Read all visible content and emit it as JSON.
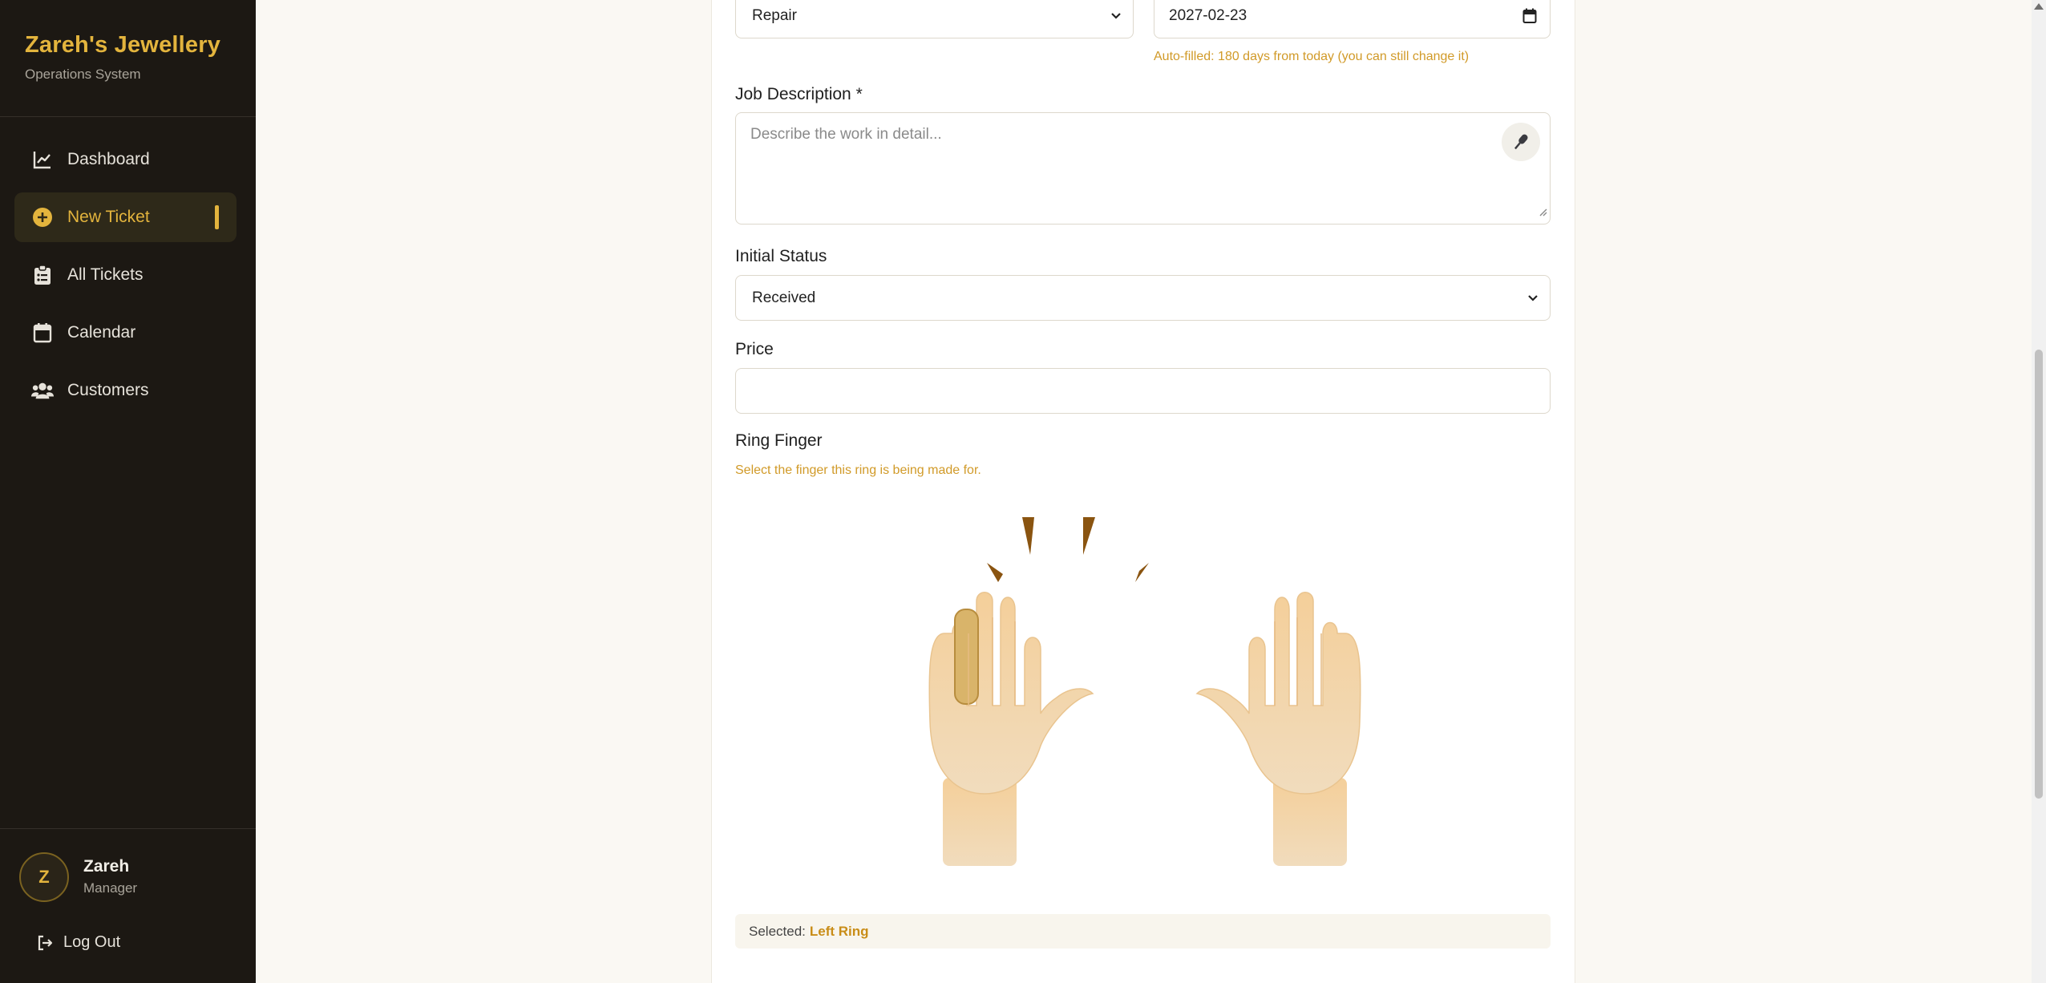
{
  "sidebar": {
    "brand_title": "Zareh's Jewellery",
    "brand_subtitle": "Operations System",
    "items": [
      {
        "label": "Dashboard",
        "icon": "chart-line-icon"
      },
      {
        "label": "New Ticket",
        "icon": "plus-circle-icon",
        "active": true
      },
      {
        "label": "All Tickets",
        "icon": "clipboard-list-icon"
      },
      {
        "label": "Calendar",
        "icon": "calendar-icon"
      },
      {
        "label": "Customers",
        "icon": "users-icon"
      }
    ],
    "user": {
      "initial": "Z",
      "name": "Zareh",
      "role": "Manager"
    },
    "logout_label": "Log Out"
  },
  "form": {
    "job_type_value": "Repair",
    "due_date_value": "2027-02-23",
    "due_date_hint": "Auto-filled: 180 days from today (you can still change it)",
    "job_description_label": "Job Description *",
    "job_description_placeholder": "Describe the work in detail...",
    "initial_status_label": "Initial Status",
    "initial_status_value": "Received",
    "price_label": "Price",
    "price_value": "",
    "ring_finger_label": "Ring Finger",
    "ring_finger_hint": "Select the finger this ring is being made for.",
    "selected_prefix": "Selected:",
    "selected_value": "Left Ring"
  },
  "colors": {
    "accent": "#e3b43d",
    "sidebar_bg": "#1c1813",
    "hint": "#d19a28",
    "selected_finger": "#d9b46a"
  }
}
